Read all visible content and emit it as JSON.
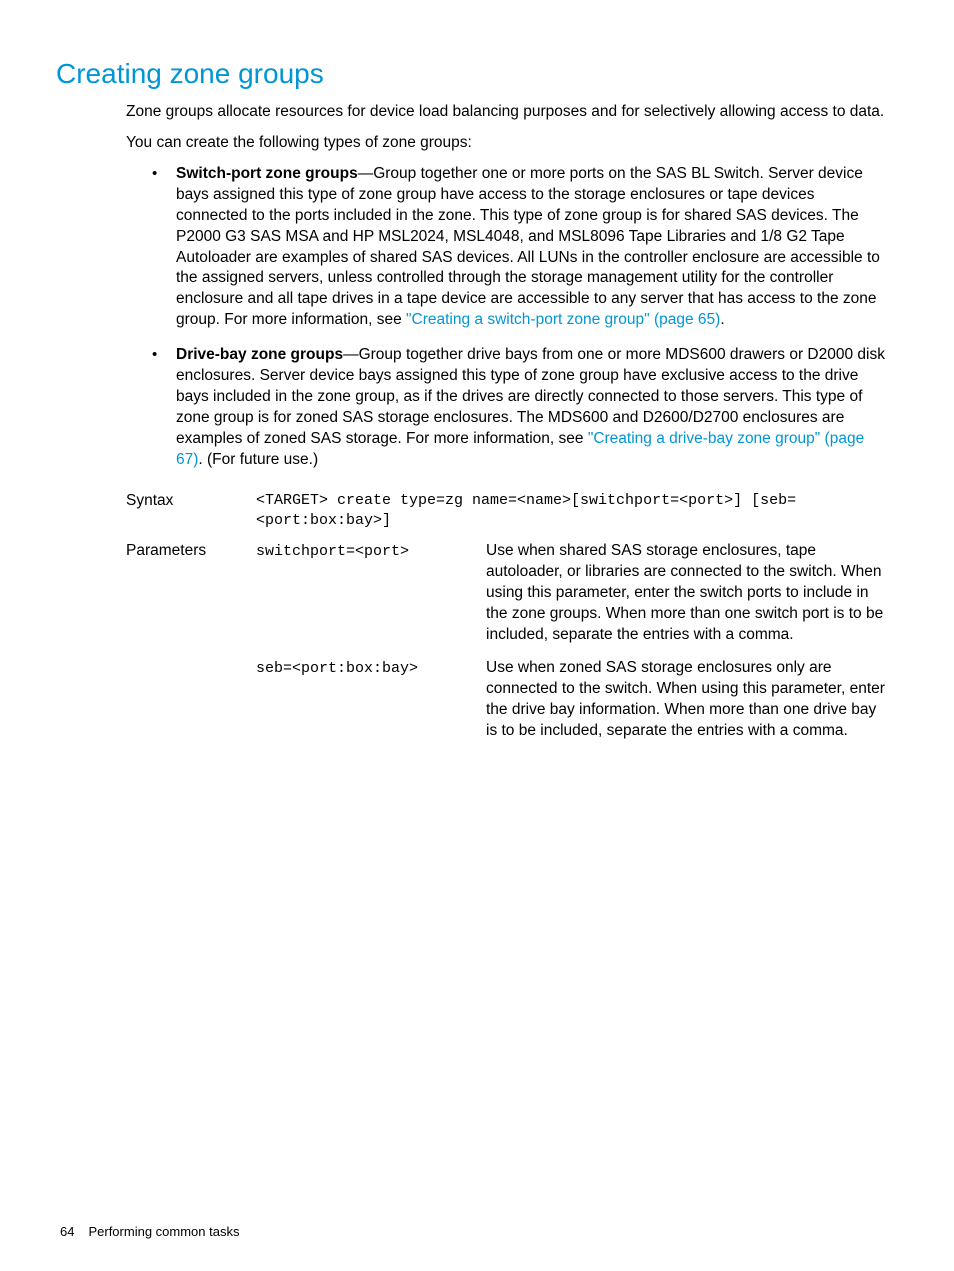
{
  "heading": "Creating zone groups",
  "intro": {
    "p1": "Zone groups allocate resources for device load balancing purposes and for selectively allowing access to data.",
    "p2": "You can create the following types of zone groups:"
  },
  "bullets": {
    "b1": {
      "title": "Switch-port zone groups",
      "text": "—Group together one or more ports on the SAS BL Switch. Server device bays assigned this type of zone group have access to the storage enclosures or tape devices connected to the ports included in the zone. This type of zone group is for shared SAS devices. The P2000 G3 SAS MSA and HP MSL2024, MSL4048, and MSL8096 Tape Libraries and 1/8 G2 Tape Autoloader are examples of shared SAS devices. All LUNs in the controller enclosure are accessible to the assigned servers, unless controlled through the storage management utility for the controller enclosure and all tape drives in a tape device are accessible to any server that has access to the zone group. For more information, see ",
      "link": "\"Creating a switch-port zone group\" (page 65)",
      "after": "."
    },
    "b2": {
      "title": "Drive-bay zone groups",
      "text": "—Group together drive bays from one or more MDS600 drawers or D2000 disk enclosures. Server device bays assigned this type of zone group have exclusive access to the drive bays included in the zone group, as if the drives are directly connected to those servers. This type of zone group is for zoned SAS storage enclosures. The MDS600 and D2600/D2700 enclosures are examples of zoned SAS storage. For more information, see ",
      "link": "\"Creating a drive-bay zone group\" (page 67)",
      "after": ". (For future use.)"
    }
  },
  "syntax": {
    "label": "Syntax",
    "value": "<TARGET> create type=zg name=<name>[switchport=<port>] [seb=<port:box:bay>]"
  },
  "parameters": {
    "label": "Parameters",
    "rows": [
      {
        "name": "switchport=<port>",
        "desc": "Use when shared SAS storage enclosures, tape autoloader, or libraries are connected to the switch. When using this parameter, enter the switch ports to include in the zone groups. When more than one switch port is to be included, separate the entries with a comma."
      },
      {
        "name": "seb=<port:box:bay>",
        "desc": "Use when zoned SAS storage enclosures only are connected to the switch. When using this parameter, enter the drive bay information. When more than one drive bay is to be included, separate the entries with a comma."
      }
    ]
  },
  "footer": {
    "page": "64",
    "title": "Performing common tasks"
  }
}
